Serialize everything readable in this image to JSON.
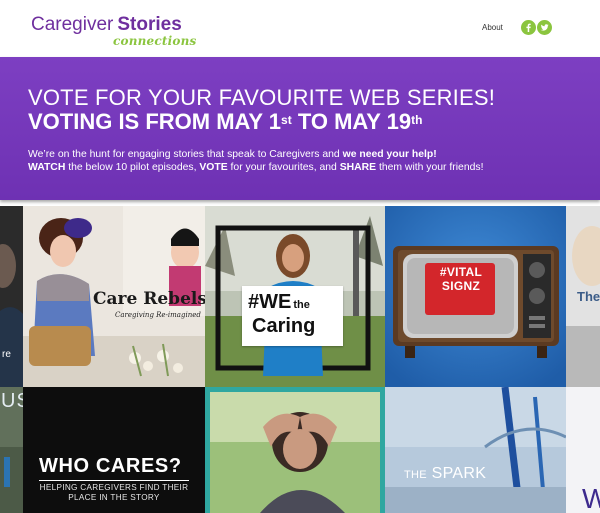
{
  "header": {
    "logo_word1": "Caregiver",
    "logo_word2": "Stories",
    "logo_tagline": "connections",
    "nav_about": "About",
    "social": [
      {
        "icon": "facebook-icon",
        "glyph": "f"
      },
      {
        "icon": "twitter-icon",
        "glyph": "bird"
      }
    ]
  },
  "hero": {
    "line1": "VOTE FOR YOUR FAVOURITE WEB SERIES!",
    "line2": {
      "pre": "VOTING IS FROM MAY 1",
      "sup1": "st",
      "mid": " TO MAY 19",
      "sup2": "th"
    },
    "paragraph": {
      "p1": "We’re on the hunt for engaging stories that speak to Caregivers and ",
      "p1_bold": "we need your help!",
      "watch": "WATCH",
      "p2": " the below 10 pilot episodes, ",
      "vote": "VOTE",
      "p3": " for your favourites, and ",
      "share": "SHARE",
      "p4": " them with your friends!"
    }
  },
  "tiles": {
    "care_rebels": {
      "title": "Care Rebels",
      "subtitle": "Caregiving Re-imagined"
    },
    "we_the_caring": {
      "hash_we": "#WE",
      "the": "the",
      "caring": "Caring"
    },
    "vital_signz": {
      "title": "#VITAL SIGNZ"
    },
    "partial_right_top": {
      "text": "The"
    },
    "partial_left_top": {
      "text": "re"
    },
    "partial_left_bottom": {
      "text": "US"
    },
    "who_cares": {
      "title": "WHO CARES?",
      "subtitle": "HELPING CAREGIVERS FIND THEIR PLACE IN THE STORY"
    },
    "the_spark": {
      "the": "THE",
      "spark": " SPARK"
    },
    "partial_right_bottom": {
      "text": "W"
    }
  },
  "colors": {
    "brand_purple": "#6f2f9e",
    "brand_green": "#8bc53f",
    "hero_bg": "#7d3fc2",
    "vital_red": "#d3262b",
    "tile_blue": "#2d74c2"
  }
}
